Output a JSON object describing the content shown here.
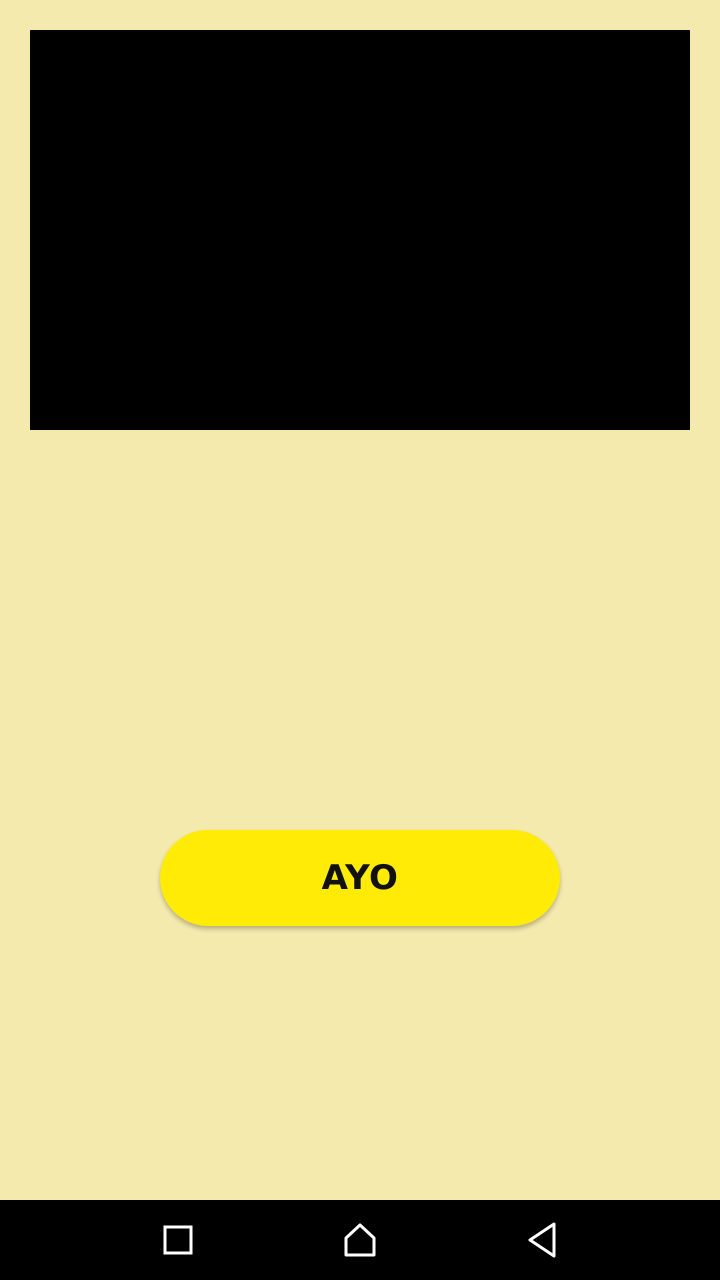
{
  "main": {
    "button_label": "AYO"
  },
  "nav_bar": {
    "recents_icon": "square-icon",
    "home_icon": "home-icon",
    "back_icon": "back-triangle-icon"
  },
  "colors": {
    "background": "#f5eaad",
    "media_frame": "#000000",
    "button": "#ffeb05",
    "nav_bar": "#000000",
    "nav_icons": "#ffffff"
  }
}
